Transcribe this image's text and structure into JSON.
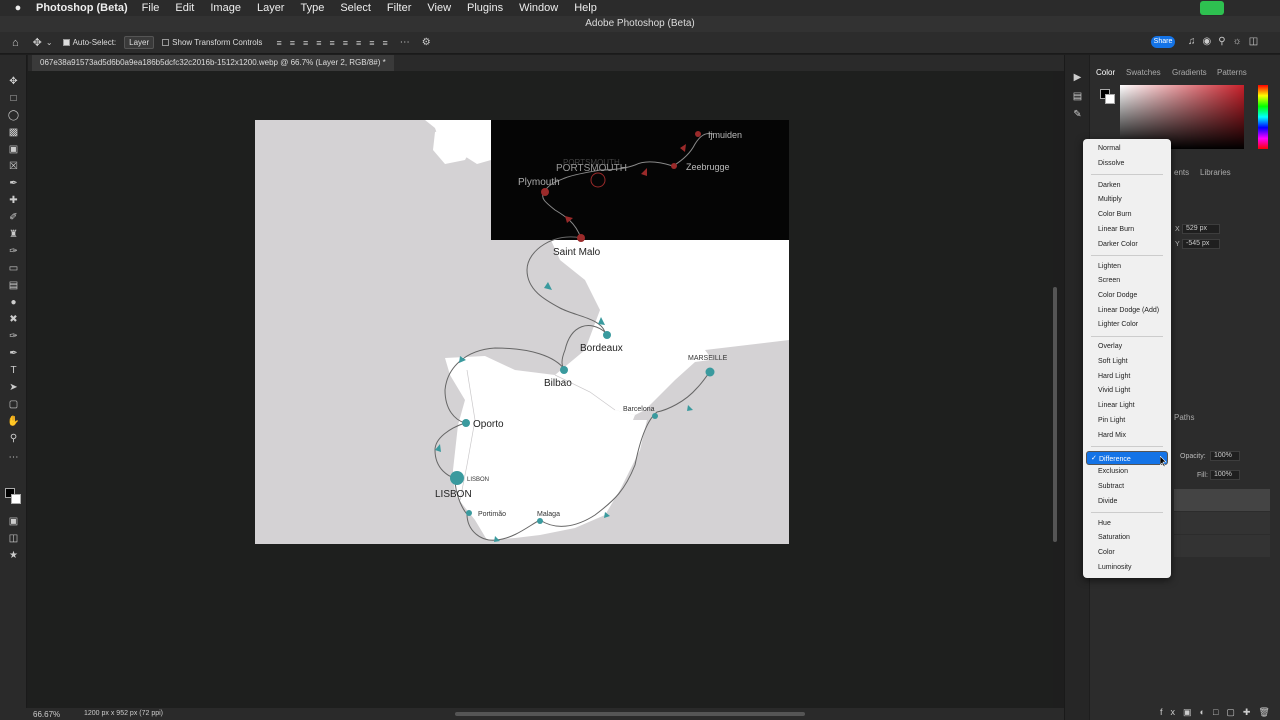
{
  "mac_menu": {
    "apple": "",
    "app_name": "Photoshop (Beta)",
    "items": [
      "File",
      "Edit",
      "Image",
      "Layer",
      "Type",
      "Select",
      "Filter",
      "View",
      "Plugins",
      "Window",
      "Help"
    ]
  },
  "window_title": "Adobe Photoshop (Beta)",
  "options_bar": {
    "auto_select_label": "Auto-Select:",
    "auto_select_value": "Layer",
    "show_transform_label": "Show Transform Controls",
    "share_label": "Share"
  },
  "doc_tab": {
    "title": "067e38a91573ad5d6b0a9ea186b5dcfc32c2016b-1512x1200.webp @ 66.7% (Layer 2, RGB/8#) *"
  },
  "status": {
    "zoom": "66.67%",
    "dimensions": "1200 px x 952 px (72 ppi)"
  },
  "map_labels": {
    "ijmuiden": "Ijmuiden",
    "zeebrugge": "Zeebrugge",
    "portsmouth_small": "PORTSMOUTH",
    "portsmouth": "PORTSMOUTH",
    "plymouth": "Plymouth",
    "saint_malo": "Saint Malo",
    "bordeaux": "Bordeaux",
    "bilbao": "Bilbao",
    "marseille": "MARSEILLE",
    "barcelona": "Barcelona",
    "oporto": "Oporto",
    "lisbon_small": "LISBON",
    "lisbon": "LISBON",
    "portimao": "Portimão",
    "malaga": "Malaga"
  },
  "panels": {
    "color_tabs": [
      "Color",
      "Swatches",
      "Gradients",
      "Patterns"
    ],
    "mid_tabs": [
      "ents",
      "Libraries"
    ],
    "x_label": "X",
    "x_value": "529 px",
    "y_label": "Y",
    "y_value": "-545 px",
    "paths_tab": "Paths",
    "opacity_label": "Opacity:",
    "opacity_value": "100%",
    "fill_label": "Fill:",
    "fill_value": "100%"
  },
  "blend_menu": {
    "selected": "Difference",
    "check": "✓",
    "groups": [
      [
        "Normal",
        "Dissolve"
      ],
      [
        "Darken",
        "Multiply",
        "Color Burn",
        "Linear Burn",
        "Darker Color"
      ],
      [
        "Lighten",
        "Screen",
        "Color Dodge",
        "Linear Dodge (Add)",
        "Lighter Color"
      ],
      [
        "Overlay",
        "Soft Light",
        "Hard Light",
        "Vivid Light",
        "Linear Light",
        "Pin Light",
        "Hard Mix"
      ],
      [
        "Difference",
        "Exclusion",
        "Subtract",
        "Divide"
      ],
      [
        "Hue",
        "Saturation",
        "Color",
        "Luminosity"
      ]
    ]
  },
  "colors": {
    "accent": "#1473e6",
    "route_teal": "#3a9a9e",
    "route_red": "#9a2a2a",
    "map_sea": "#d4d2d4",
    "map_land": "#ffffff"
  }
}
